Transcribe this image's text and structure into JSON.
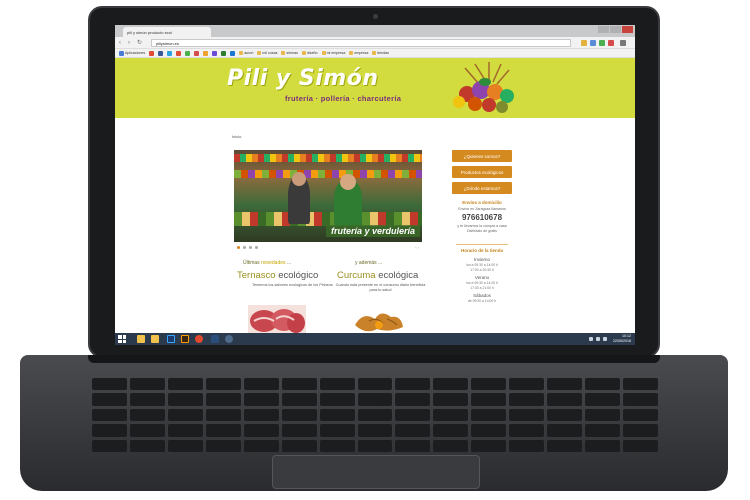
{
  "browser": {
    "tab_title": "pili y simón producto ecol",
    "url": "piliysimon.es",
    "bookmarks": [
      "Aplicaciones",
      "aurori",
      "mil cosas",
      "síemas",
      "diseño",
      "mi empresa",
      "empresa",
      "tiendas"
    ]
  },
  "site": {
    "logo_title": "Pili y Simón",
    "logo_subtitle": "frutería · pollería · charcutería",
    "breadcrumb": "Inicio",
    "hero_caption": "frutería y verdulería",
    "sections": {
      "left_heading_prefix": "Últimas",
      "left_heading_highlight": "novedades",
      "left_heading_suffix": "...",
      "right_heading_prefix": "y además",
      "right_heading_suffix": "...",
      "product1_name": "Ternasco",
      "product1_tag": "ecológico",
      "product1_desc": "Tenemos los sabores ecológicos de los Pirineos",
      "product2_name": "Curcuma",
      "product2_tag": "ecológica",
      "product2_desc": "Cuando está presente en el consumo diario beneficia para tu salud"
    },
    "sidebar": {
      "btn1": "¿Quienes somos?",
      "btn2": "Productos ecológicos",
      "btn3": "¿Dónde estamos?",
      "contact_title": "Envíos a domicilio",
      "contact_text": "Envíos en Zaragoza llámanos",
      "phone": "976610678",
      "contact_note": "y te llevamos la compra a casa",
      "contact_note2": "Disfrútalo de gratis",
      "hours_title": "Horario de la tienda",
      "winter": "Invierno",
      "winter_hours": "lun a 09:30 a 14:00 h",
      "winter_hours2": "17:00 a 20:30 h",
      "summer": "Verano",
      "summer_hours": "lun a 09:30 a 14:00 h",
      "summer_hours2": "17:30 a 21:00 h",
      "saturday": "Sábados",
      "saturday_hours": "de 09:30 a 14:00 h"
    }
  },
  "taskbar": {
    "time": "10:12",
    "date": "22/05/2016"
  },
  "colors": {
    "header_green": "#d2dc3f",
    "accent_orange": "#d58a1f",
    "logo_purple": "#7b2f7a",
    "taskbar": "#2b3a4d"
  }
}
